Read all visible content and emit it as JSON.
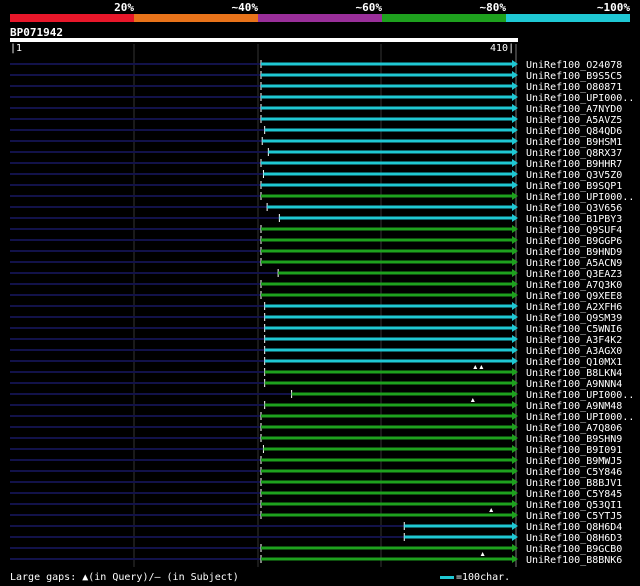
{
  "legend": {
    "colors": [
      "#e8172a",
      "#e8731a",
      "#9a2f9a",
      "#1ea11e",
      "#1fc8d4"
    ],
    "labels": [
      "20%",
      "~40%",
      "~60%",
      "~80%",
      "~100%"
    ]
  },
  "query": {
    "name": "BP071942",
    "start": "1",
    "end": "410"
  },
  "footer": {
    "gaps": "Large gaps: ▲(in Query)/— (in Subject)",
    "scale": "=100char."
  },
  "chart_data": {
    "type": "alignment",
    "query_length": 410,
    "hits": [
      {
        "name": "UniRef100_O24078",
        "start": 205,
        "end": 410,
        "identity": "~100%"
      },
      {
        "name": "UniRef100_B9S5C5",
        "start": 205,
        "end": 410,
        "identity": "~100%"
      },
      {
        "name": "UniRef100_O80871",
        "start": 205,
        "end": 410,
        "identity": "~100%"
      },
      {
        "name": "UniRef100_UPI000..",
        "start": 205,
        "end": 410,
        "identity": "~100%"
      },
      {
        "name": "UniRef100_A7NYD0",
        "start": 205,
        "end": 410,
        "identity": "~100%"
      },
      {
        "name": "UniRef100_A5AVZ5",
        "start": 205,
        "end": 410,
        "identity": "~100%"
      },
      {
        "name": "UniRef100_Q84QD6",
        "start": 208,
        "end": 410,
        "identity": "~100%"
      },
      {
        "name": "UniRef100_B9HSM1",
        "start": 206,
        "end": 410,
        "identity": "~100%"
      },
      {
        "name": "UniRef100_Q8RX37",
        "start": 211,
        "end": 410,
        "identity": "~100%"
      },
      {
        "name": "UniRef100_B9HHR7",
        "start": 205,
        "end": 410,
        "identity": "~100%"
      },
      {
        "name": "UniRef100_Q3V5Z0",
        "start": 207,
        "end": 410,
        "identity": "~100%"
      },
      {
        "name": "UniRef100_B9SQP1",
        "start": 205,
        "end": 410,
        "identity": "~100%"
      },
      {
        "name": "UniRef100_UPI000..",
        "start": 205,
        "end": 410,
        "identity": "~80%"
      },
      {
        "name": "UniRef100_Q3V656",
        "start": 210,
        "end": 410,
        "identity": "~100%"
      },
      {
        "name": "UniRef100_B1PBY3",
        "start": 220,
        "end": 410,
        "identity": "~100%"
      },
      {
        "name": "UniRef100_Q9SUF4",
        "start": 205,
        "end": 410,
        "identity": "~80%"
      },
      {
        "name": "UniRef100_B9GGP6",
        "start": 205,
        "end": 410,
        "identity": "~80%"
      },
      {
        "name": "UniRef100_B9HND9",
        "start": 205,
        "end": 410,
        "identity": "~80%"
      },
      {
        "name": "UniRef100_A5ACN9",
        "start": 205,
        "end": 410,
        "identity": "~80%"
      },
      {
        "name": "UniRef100_Q3EAZ3",
        "start": 219,
        "end": 410,
        "identity": "~80%"
      },
      {
        "name": "UniRef100_A7Q3K0",
        "start": 205,
        "end": 410,
        "identity": "~80%"
      },
      {
        "name": "UniRef100_Q9XEE8",
        "start": 205,
        "end": 410,
        "identity": "~80%"
      },
      {
        "name": "UniRef100_A2XFH6",
        "start": 208,
        "end": 410,
        "identity": "~100%"
      },
      {
        "name": "UniRef100_Q9SM39",
        "start": 208,
        "end": 410,
        "identity": "~100%"
      },
      {
        "name": "UniRef100_C5WNI6",
        "start": 208,
        "end": 410,
        "identity": "~100%"
      },
      {
        "name": "UniRef100_A3F4K2",
        "start": 208,
        "end": 410,
        "identity": "~100%"
      },
      {
        "name": "UniRef100_A3AGX0",
        "start": 208,
        "end": 410,
        "identity": "~100%"
      },
      {
        "name": "UniRef100_Q10MX1",
        "start": 208,
        "end": 410,
        "identity": "~100%"
      },
      {
        "name": "UniRef100_B8LKN4",
        "start": 208,
        "end": 410,
        "identity": "~80%",
        "gaps": [
          380,
          385
        ]
      },
      {
        "name": "UniRef100_A9NNN4",
        "start": 208,
        "end": 410,
        "identity": "~80%"
      },
      {
        "name": "UniRef100_UPI000..",
        "start": 230,
        "end": 410,
        "identity": "~80%"
      },
      {
        "name": "UniRef100_A9NM48",
        "start": 208,
        "end": 410,
        "identity": "~80%",
        "gaps": [
          378
        ]
      },
      {
        "name": "UniRef100_UPI000..",
        "start": 205,
        "end": 410,
        "identity": "~80%"
      },
      {
        "name": "UniRef100_A7Q806",
        "start": 205,
        "end": 410,
        "identity": "~80%"
      },
      {
        "name": "UniRef100_B9SHN9",
        "start": 205,
        "end": 410,
        "identity": "~80%"
      },
      {
        "name": "UniRef100_B9I091",
        "start": 207,
        "end": 410,
        "identity": "~80%"
      },
      {
        "name": "UniRef100_B9MWJ5",
        "start": 205,
        "end": 410,
        "identity": "~80%"
      },
      {
        "name": "UniRef100_C5Y846",
        "start": 205,
        "end": 410,
        "identity": "~80%"
      },
      {
        "name": "UniRef100_B8BJV1",
        "start": 205,
        "end": 410,
        "identity": "~80%"
      },
      {
        "name": "UniRef100_C5Y845",
        "start": 205,
        "end": 410,
        "identity": "~80%"
      },
      {
        "name": "UniRef100_Q53QI1",
        "start": 205,
        "end": 410,
        "identity": "~80%"
      },
      {
        "name": "UniRef100_C5YTJ5",
        "start": 205,
        "end": 410,
        "identity": "~80%",
        "gaps": [
          393
        ]
      },
      {
        "name": "UniRef100_Q8H6D4",
        "start": 322,
        "end": 410,
        "identity": "~100%"
      },
      {
        "name": "UniRef100_Q8H6D3",
        "start": 322,
        "end": 410,
        "identity": "~100%"
      },
      {
        "name": "UniRef100_B9GCB0",
        "start": 205,
        "end": 410,
        "identity": "~80%"
      },
      {
        "name": "UniRef100_B8BNK6",
        "start": 205,
        "end": 410,
        "identity": "~80%",
        "gaps": [
          386
        ]
      }
    ]
  }
}
